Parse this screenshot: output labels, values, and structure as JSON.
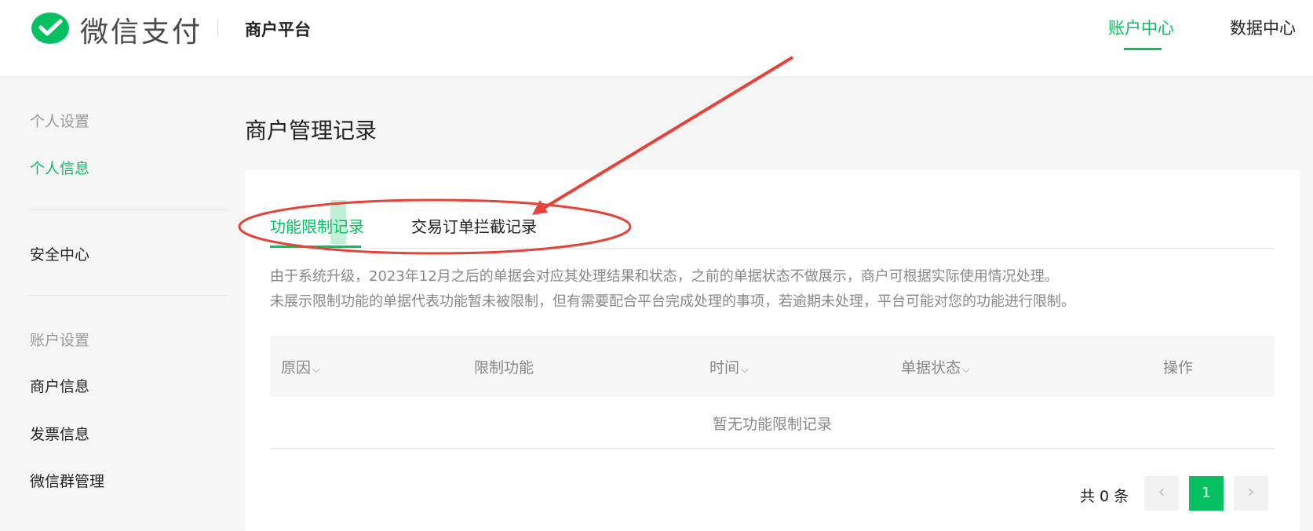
{
  "header": {
    "brand": "微信支付",
    "platform": "商户平台",
    "nav": [
      {
        "label": "账户中心",
        "active": true
      },
      {
        "label": "数据中心",
        "active": false
      }
    ]
  },
  "sidebar": {
    "personal_group": "个人设置",
    "personal_info": "个人信息",
    "security_center": "安全中心",
    "account_group": "账户设置",
    "merchant_info": "商户信息",
    "invoice_info": "发票信息",
    "wechat_group_mgmt": "微信群管理"
  },
  "main": {
    "title": "商户管理记录",
    "tabs": [
      {
        "label": "功能限制记录",
        "active": true
      },
      {
        "label": "交易订单拦截记录",
        "active": false
      }
    ],
    "notice": [
      "由于系统升级，2023年12月之后的单据会对应其处理结果和状态，之前的单据状态不做展示，商户可根据实际使用情况处理。",
      "未展示限制功能的单据代表功能暂未被限制，但有需要配合平台完成处理的事项，若逾期未处理，平台可能对您的功能进行限制。"
    ],
    "table": {
      "columns": [
        {
          "label": "原因",
          "sortable": true
        },
        {
          "label": "限制功能",
          "sortable": false
        },
        {
          "label": "时间",
          "sortable": true
        },
        {
          "label": "单据状态",
          "sortable": true
        },
        {
          "label": "操作",
          "sortable": false
        }
      ],
      "sort_caret": "⌵",
      "empty_text": "暂无功能限制记录"
    },
    "pagination": {
      "total": "共 0 条",
      "prev": "‹",
      "current": "1",
      "next": "›"
    }
  },
  "colors": {
    "accent": "#07c160",
    "annotation": "#e5423a"
  },
  "icons": {
    "logo": "wechat-pay-logo",
    "prev": "chevron-left-icon",
    "next": "chevron-right-icon",
    "sort": "chevron-down-icon"
  }
}
